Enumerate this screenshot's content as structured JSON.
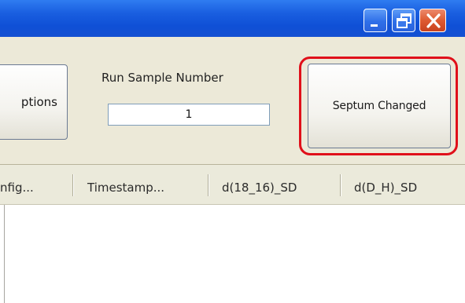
{
  "window": {
    "controls": {
      "minimize": "minimize-icon",
      "restore": "restore-icon",
      "close": "close-icon"
    }
  },
  "toolbar": {
    "options_button_label": "ptions",
    "run_sample": {
      "label": "Run Sample Number",
      "value": "1"
    },
    "septum_button_label": "Septum Changed"
  },
  "grid": {
    "columns": [
      "nfig...",
      "Timestamp...",
      "d(18_16)_SD",
      "d(D_H)_SD"
    ]
  },
  "colors": {
    "titlebar": "#1a5fe0",
    "highlight": "#e0101a",
    "close_button": "#de5a31"
  }
}
